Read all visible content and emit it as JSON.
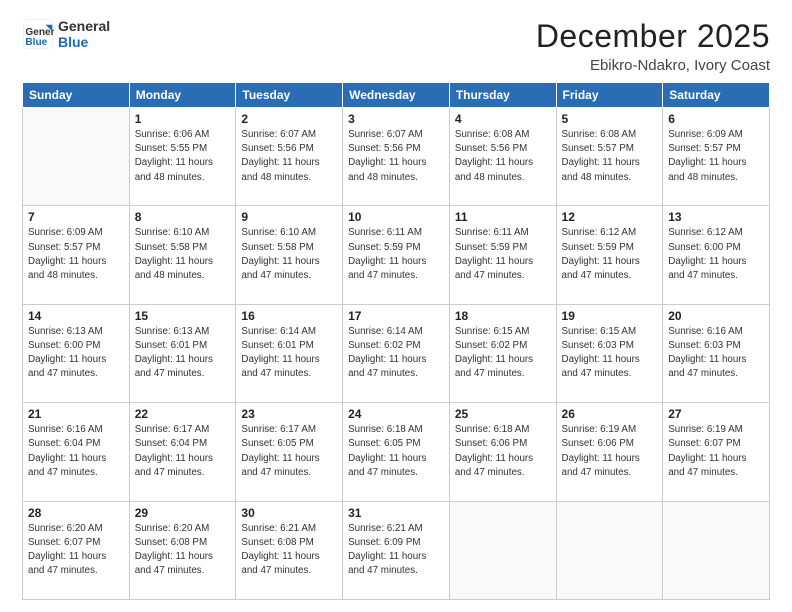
{
  "header": {
    "logo_line1": "General",
    "logo_line2": "Blue",
    "month": "December 2025",
    "location": "Ebikro-Ndakro, Ivory Coast"
  },
  "weekdays": [
    "Sunday",
    "Monday",
    "Tuesday",
    "Wednesday",
    "Thursday",
    "Friday",
    "Saturday"
  ],
  "weeks": [
    [
      {
        "day": "",
        "info": ""
      },
      {
        "day": "1",
        "info": "Sunrise: 6:06 AM\nSunset: 5:55 PM\nDaylight: 11 hours\nand 48 minutes."
      },
      {
        "day": "2",
        "info": "Sunrise: 6:07 AM\nSunset: 5:56 PM\nDaylight: 11 hours\nand 48 minutes."
      },
      {
        "day": "3",
        "info": "Sunrise: 6:07 AM\nSunset: 5:56 PM\nDaylight: 11 hours\nand 48 minutes."
      },
      {
        "day": "4",
        "info": "Sunrise: 6:08 AM\nSunset: 5:56 PM\nDaylight: 11 hours\nand 48 minutes."
      },
      {
        "day": "5",
        "info": "Sunrise: 6:08 AM\nSunset: 5:57 PM\nDaylight: 11 hours\nand 48 minutes."
      },
      {
        "day": "6",
        "info": "Sunrise: 6:09 AM\nSunset: 5:57 PM\nDaylight: 11 hours\nand 48 minutes."
      }
    ],
    [
      {
        "day": "7",
        "info": "Sunrise: 6:09 AM\nSunset: 5:57 PM\nDaylight: 11 hours\nand 48 minutes."
      },
      {
        "day": "8",
        "info": "Sunrise: 6:10 AM\nSunset: 5:58 PM\nDaylight: 11 hours\nand 48 minutes."
      },
      {
        "day": "9",
        "info": "Sunrise: 6:10 AM\nSunset: 5:58 PM\nDaylight: 11 hours\nand 47 minutes."
      },
      {
        "day": "10",
        "info": "Sunrise: 6:11 AM\nSunset: 5:59 PM\nDaylight: 11 hours\nand 47 minutes."
      },
      {
        "day": "11",
        "info": "Sunrise: 6:11 AM\nSunset: 5:59 PM\nDaylight: 11 hours\nand 47 minutes."
      },
      {
        "day": "12",
        "info": "Sunrise: 6:12 AM\nSunset: 5:59 PM\nDaylight: 11 hours\nand 47 minutes."
      },
      {
        "day": "13",
        "info": "Sunrise: 6:12 AM\nSunset: 6:00 PM\nDaylight: 11 hours\nand 47 minutes."
      }
    ],
    [
      {
        "day": "14",
        "info": "Sunrise: 6:13 AM\nSunset: 6:00 PM\nDaylight: 11 hours\nand 47 minutes."
      },
      {
        "day": "15",
        "info": "Sunrise: 6:13 AM\nSunset: 6:01 PM\nDaylight: 11 hours\nand 47 minutes."
      },
      {
        "day": "16",
        "info": "Sunrise: 6:14 AM\nSunset: 6:01 PM\nDaylight: 11 hours\nand 47 minutes."
      },
      {
        "day": "17",
        "info": "Sunrise: 6:14 AM\nSunset: 6:02 PM\nDaylight: 11 hours\nand 47 minutes."
      },
      {
        "day": "18",
        "info": "Sunrise: 6:15 AM\nSunset: 6:02 PM\nDaylight: 11 hours\nand 47 minutes."
      },
      {
        "day": "19",
        "info": "Sunrise: 6:15 AM\nSunset: 6:03 PM\nDaylight: 11 hours\nand 47 minutes."
      },
      {
        "day": "20",
        "info": "Sunrise: 6:16 AM\nSunset: 6:03 PM\nDaylight: 11 hours\nand 47 minutes."
      }
    ],
    [
      {
        "day": "21",
        "info": "Sunrise: 6:16 AM\nSunset: 6:04 PM\nDaylight: 11 hours\nand 47 minutes."
      },
      {
        "day": "22",
        "info": "Sunrise: 6:17 AM\nSunset: 6:04 PM\nDaylight: 11 hours\nand 47 minutes."
      },
      {
        "day": "23",
        "info": "Sunrise: 6:17 AM\nSunset: 6:05 PM\nDaylight: 11 hours\nand 47 minutes."
      },
      {
        "day": "24",
        "info": "Sunrise: 6:18 AM\nSunset: 6:05 PM\nDaylight: 11 hours\nand 47 minutes."
      },
      {
        "day": "25",
        "info": "Sunrise: 6:18 AM\nSunset: 6:06 PM\nDaylight: 11 hours\nand 47 minutes."
      },
      {
        "day": "26",
        "info": "Sunrise: 6:19 AM\nSunset: 6:06 PM\nDaylight: 11 hours\nand 47 minutes."
      },
      {
        "day": "27",
        "info": "Sunrise: 6:19 AM\nSunset: 6:07 PM\nDaylight: 11 hours\nand 47 minutes."
      }
    ],
    [
      {
        "day": "28",
        "info": "Sunrise: 6:20 AM\nSunset: 6:07 PM\nDaylight: 11 hours\nand 47 minutes."
      },
      {
        "day": "29",
        "info": "Sunrise: 6:20 AM\nSunset: 6:08 PM\nDaylight: 11 hours\nand 47 minutes."
      },
      {
        "day": "30",
        "info": "Sunrise: 6:21 AM\nSunset: 6:08 PM\nDaylight: 11 hours\nand 47 minutes."
      },
      {
        "day": "31",
        "info": "Sunrise: 6:21 AM\nSunset: 6:09 PM\nDaylight: 11 hours\nand 47 minutes."
      },
      {
        "day": "",
        "info": ""
      },
      {
        "day": "",
        "info": ""
      },
      {
        "day": "",
        "info": ""
      }
    ]
  ]
}
